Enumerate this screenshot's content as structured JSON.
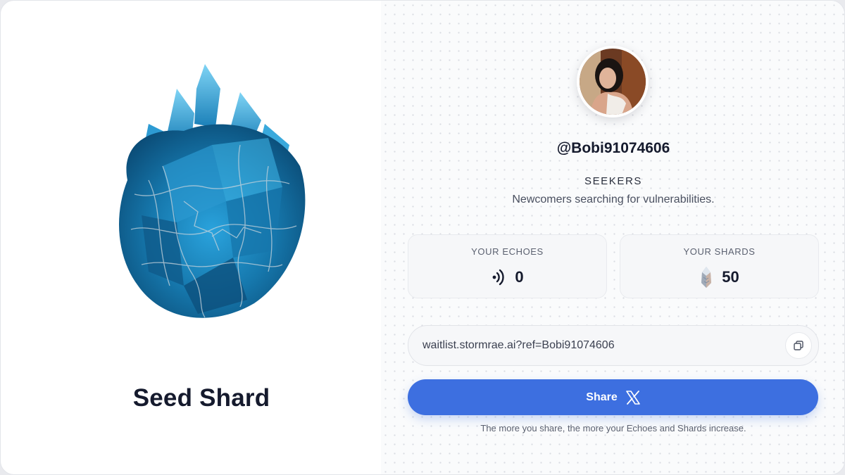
{
  "shard": {
    "title": "Seed Shard",
    "image_icon": "blue-crystal-shard"
  },
  "profile": {
    "avatar_icon": "user-avatar-photo",
    "username": "@Bobi91074606",
    "tier": {
      "name": "SEEKERS",
      "description": "Newcomers searching for vulnerabilities."
    }
  },
  "stats": {
    "echoes": {
      "label": "YOUR ECHOES",
      "value": "0",
      "icon": "echo-waves-icon"
    },
    "shards": {
      "label": "YOUR SHARDS",
      "value": "50",
      "icon": "crystal-shard-icon"
    }
  },
  "referral": {
    "link": "waitlist.stormrae.ai?ref=Bobi91074606",
    "copy_icon": "copy-icon"
  },
  "share": {
    "label": "Share",
    "icon": "x-logo-icon",
    "hint": "The more you share, the more your Echoes and Shards increase."
  },
  "colors": {
    "accent": "#3d6fe0",
    "text_primary": "#151a2d",
    "text_muted": "#5b6170",
    "crystal": "#1e8ec4"
  }
}
